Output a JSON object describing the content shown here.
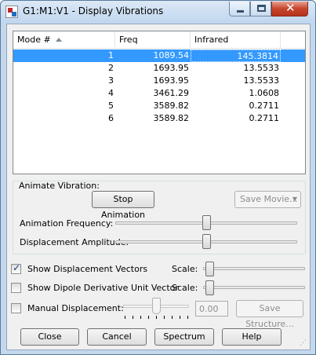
{
  "window": {
    "title": "G1:M1:V1 - Display Vibrations"
  },
  "table": {
    "columns": [
      "Mode #",
      "Freq",
      "Infrared"
    ],
    "rows": [
      {
        "mode": "1",
        "freq": "1089.54",
        "ir": "145.3814",
        "selected": true
      },
      {
        "mode": "2",
        "freq": "1693.95",
        "ir": "13.5533"
      },
      {
        "mode": "3",
        "freq": "1693.95",
        "ir": "13.5533"
      },
      {
        "mode": "4",
        "freq": "3461.29",
        "ir": "1.0608"
      },
      {
        "mode": "5",
        "freq": "3589.82",
        "ir": "0.2711"
      },
      {
        "mode": "6",
        "freq": "3589.82",
        "ir": "0.2711"
      }
    ]
  },
  "animate": {
    "group_label": "Animate Vibration:",
    "stop_button": "Stop Animation",
    "save_movie": "Save Movie...",
    "frequency_label": "Animation Frequency:",
    "amplitude_label": "Displacement Amplitude:",
    "frequency_level": 0.5,
    "amplitude_level": 0.5
  },
  "options": {
    "show_vectors": {
      "label": "Show Displacement Vectors",
      "checked": true,
      "scale_label": "Scale:"
    },
    "show_dipole": {
      "label": "Show Dipole Derivative Unit Vector",
      "checked": false,
      "scale_label": "Scale:"
    },
    "manual": {
      "label": "Manual Displacement:",
      "checked": false,
      "value": "0.00",
      "save_structure": "Save Structure..."
    }
  },
  "buttons": {
    "close": "Close",
    "cancel": "Cancel",
    "spectrum": "Spectrum",
    "help": "Help"
  },
  "colors": {
    "selection": "#3399ff",
    "check_mark": "#1a3c7a"
  }
}
